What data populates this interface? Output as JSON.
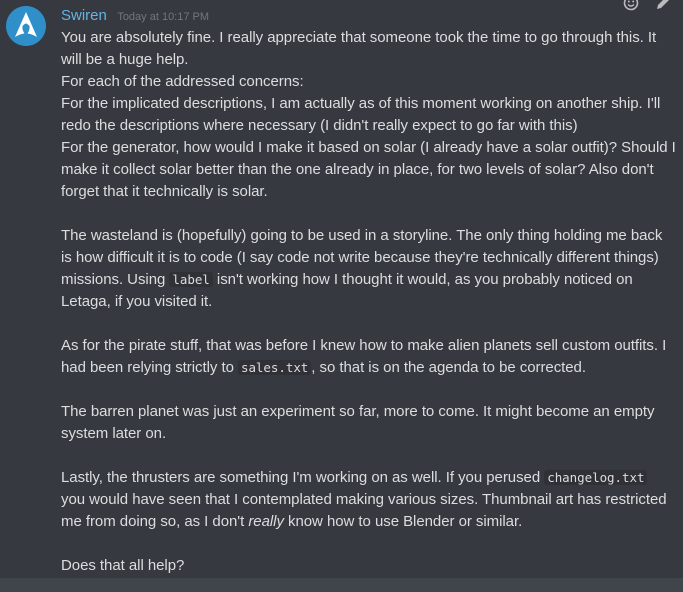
{
  "message": {
    "username": "Swiren",
    "timestamp": "Today at 10:17 PM",
    "colors": {
      "username": "#64b4e6",
      "text": "#dcddde",
      "timestamp": "#72767d",
      "background": "#36393f",
      "avatar": "#2f8fc9"
    },
    "avatar_icon": "arch-linux-logo",
    "toolbar_icons": [
      "add-reaction-icon",
      "edit-pencil-icon"
    ],
    "p1_line1": "You are absolutely fine. I really appreciate that someone took the time to go through this. It",
    "p1_line2": "will be a huge help.",
    "p2": "For each of the addressed concerns:",
    "p3_line1": "For the implicated descriptions, I am actually as of this moment working on another ship. I'll",
    "p3_line2": "redo the descriptions where necessary (I didn't really expect to go far with this)",
    "p4_line1": "For the generator, how would I make it based on solar (I already have a solar outfit)? Should I",
    "p4_line2": "make it collect solar better than the one already in place, for two levels of solar? Also don't",
    "p4_line3": "forget that it technically is solar.",
    "p5_line1": "The wasteland is (hopefully) going to be used in a storyline. The only thing holding me back",
    "p5_line2": "is how difficult it is to code (I say code not write because they're technically different things)",
    "p5_line3_a": "missions. Using ",
    "p5_line3_code": "label",
    "p5_line3_b": " isn't working how I thought it would, as you probably noticed on",
    "p5_line4": "Letaga, if you visited it.",
    "p6_line1": "As for the pirate stuff, that was before I knew how to make alien planets sell custom outfits. I",
    "p6_line2_a": "had been relying strictly to ",
    "p6_line2_code": "sales.txt",
    "p6_line2_b": ", so that is on the agenda to be corrected.",
    "p7_line1": "The barren planet was just an experiment so far, more to come. It might become an empty",
    "p7_line2": "system later on.",
    "p8_line1_a": "Lastly, the thrusters are something I'm working on as well. If you perused ",
    "p8_line1_code": "changelog.txt",
    "p8_line2": "you would have seen that I contemplated making various sizes. Thumbnail art has restricted",
    "p8_line3_a": "me from doing so, as I don't ",
    "p8_line3_em": "really",
    "p8_line3_b": " know how to use Blender or similar.",
    "p9": "Does that all help?"
  }
}
